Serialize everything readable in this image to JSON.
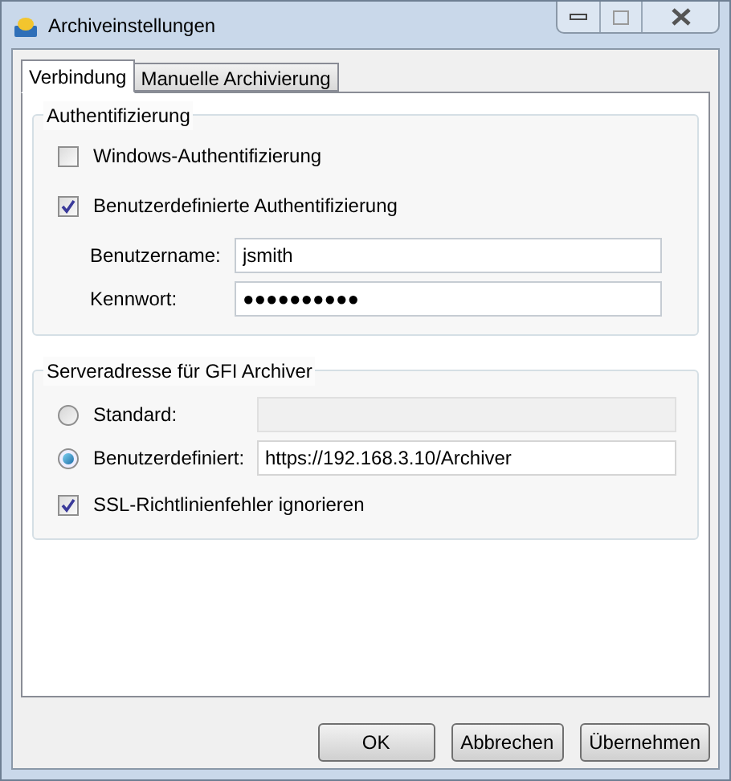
{
  "window": {
    "title": "Archiveinstellungen"
  },
  "tabs": [
    {
      "label": "Verbindung",
      "selected": true
    },
    {
      "label": "Manuelle Archivierung",
      "selected": false
    }
  ],
  "auth": {
    "title": "Authentifizierung",
    "options": [
      {
        "label": "Windows-Authentifizierung",
        "checked": false
      },
      {
        "label": "Benutzerdefinierte Authentifizierung",
        "checked": true
      }
    ],
    "fields": [
      {
        "label": "Benutzername:",
        "value": "jsmith"
      },
      {
        "label": "Kennwort:",
        "value": "●●●●●●●●●●"
      }
    ]
  },
  "server": {
    "title": "Serveradresse für GFI Archiver",
    "options": [
      {
        "label": "Standard:",
        "selected": false,
        "disabled": true
      },
      {
        "label": "Benutzerdefiniert:",
        "selected": true,
        "value": "https://192.168.3.10/Archiver",
        "disabled": false
      }
    ],
    "ssl": {
      "label": "SSL-Richtlinienfehler ignorieren",
      "checked": true
    }
  },
  "buttons": [
    "OK",
    "Abbrechen",
    "Übernehmen"
  ]
}
